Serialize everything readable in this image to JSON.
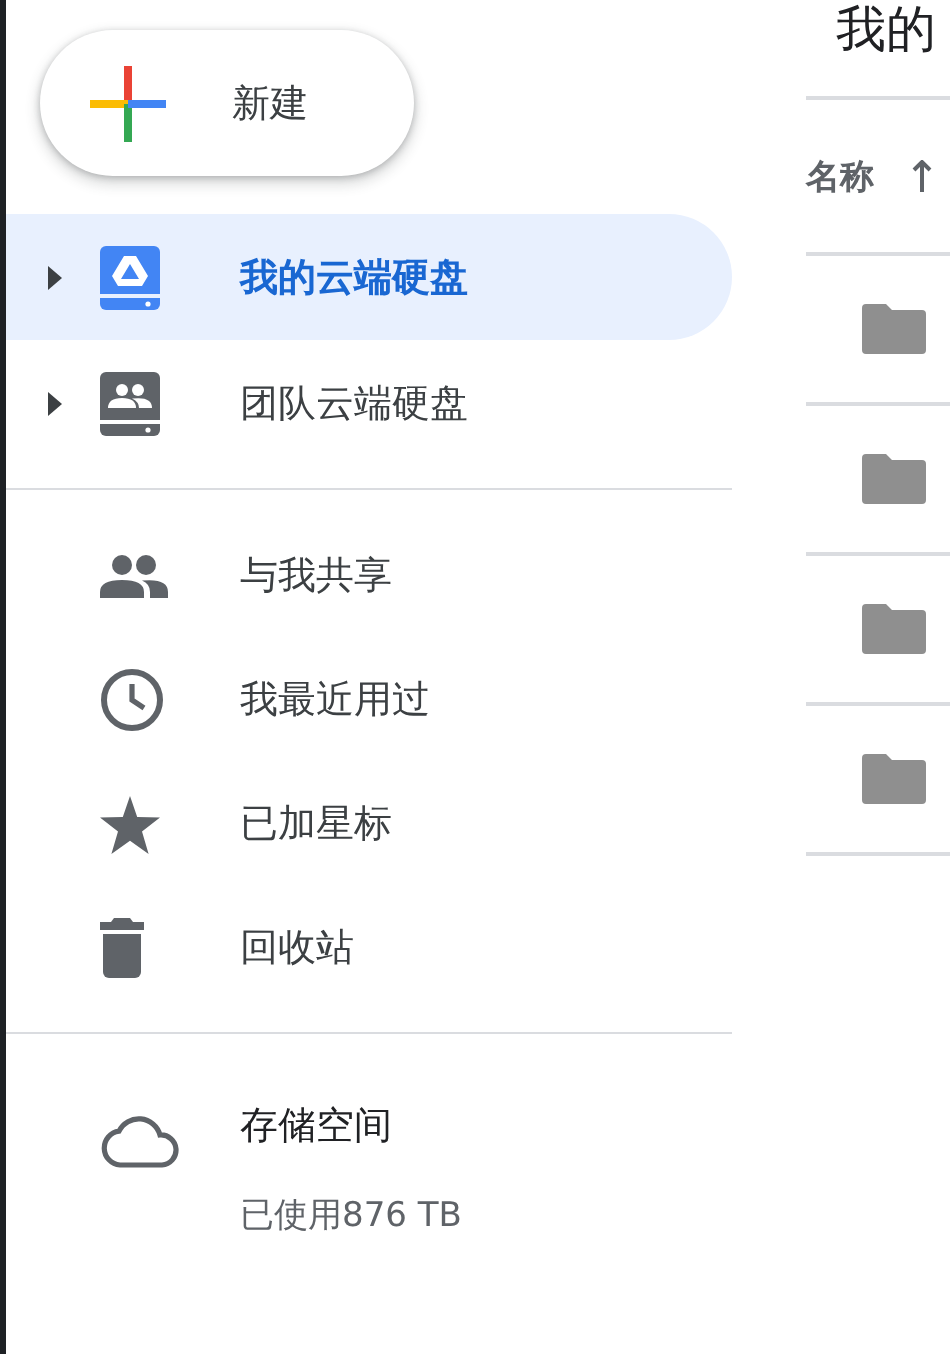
{
  "new_button": {
    "label": "新建"
  },
  "nav_groups": [
    {
      "items": [
        {
          "kind": "my-drive",
          "label": "我的云端硬盘",
          "selected": true,
          "expanded": false
        },
        {
          "kind": "shared-drives",
          "label": "团队云端硬盘",
          "selected": false,
          "expanded": false
        }
      ]
    },
    {
      "items": [
        {
          "kind": "shared",
          "label": "与我共享",
          "selected": false
        },
        {
          "kind": "recent",
          "label": "我最近用过",
          "selected": false
        },
        {
          "kind": "starred",
          "label": "已加星标",
          "selected": false
        },
        {
          "kind": "trash",
          "label": "回收站",
          "selected": false
        }
      ]
    }
  ],
  "storage": {
    "label": "存储空间",
    "usage": "已使用876 TB"
  },
  "main": {
    "title": "我的",
    "column_header": "名称",
    "rows": [
      {
        "kind": "folder"
      },
      {
        "kind": "folder"
      },
      {
        "kind": "folder"
      },
      {
        "kind": "folder"
      }
    ]
  }
}
